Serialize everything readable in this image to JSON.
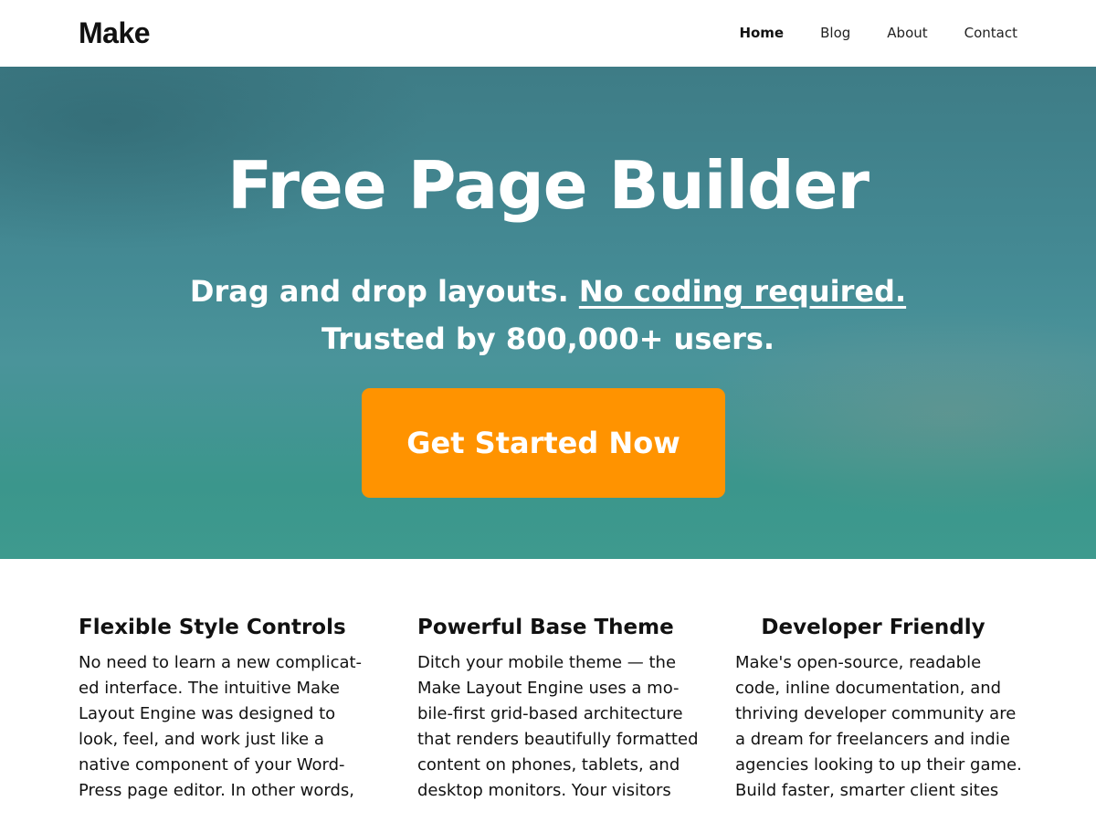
{
  "header": {
    "logo": "Make",
    "nav": [
      {
        "label": "Home",
        "active": true
      },
      {
        "label": "Blog",
        "active": false
      },
      {
        "label": "About",
        "active": false
      },
      {
        "label": "Contact",
        "active": false
      }
    ]
  },
  "hero": {
    "title": "Free Page Builder",
    "subtitle_part1": "Drag and drop layouts. ",
    "subtitle_link": "No coding required.",
    "subtitle_line2": "Trusted by 800,000+ users.",
    "cta_label": "Get Started Now",
    "cta_color": "#ff9300",
    "background_color": "#448a94"
  },
  "features": [
    {
      "title": "Flexible Style Controls",
      "text": "No need to learn a new complicat-\ned interface. The intuitive Make\nLayout Engine was designed to\nlook, feel, and work just like a\nnative component of your Word-\nPress page editor. In other words,"
    },
    {
      "title": "Powerful Base Theme",
      "text": "Ditch your mobile theme — the\nMake Layout Engine uses a mo-\nbile-first grid-based architecture\nthat renders beautifully formatted\ncontent on phones, tablets, and\ndesktop monitors. Your visitors"
    },
    {
      "title": "Developer Friendly",
      "text": "Make's open-source, readable\ncode, inline documentation, and\nthriving developer community are\na dream for freelancers and indie\nagencies looking to up their game.\nBuild faster, smarter client sites"
    }
  ]
}
